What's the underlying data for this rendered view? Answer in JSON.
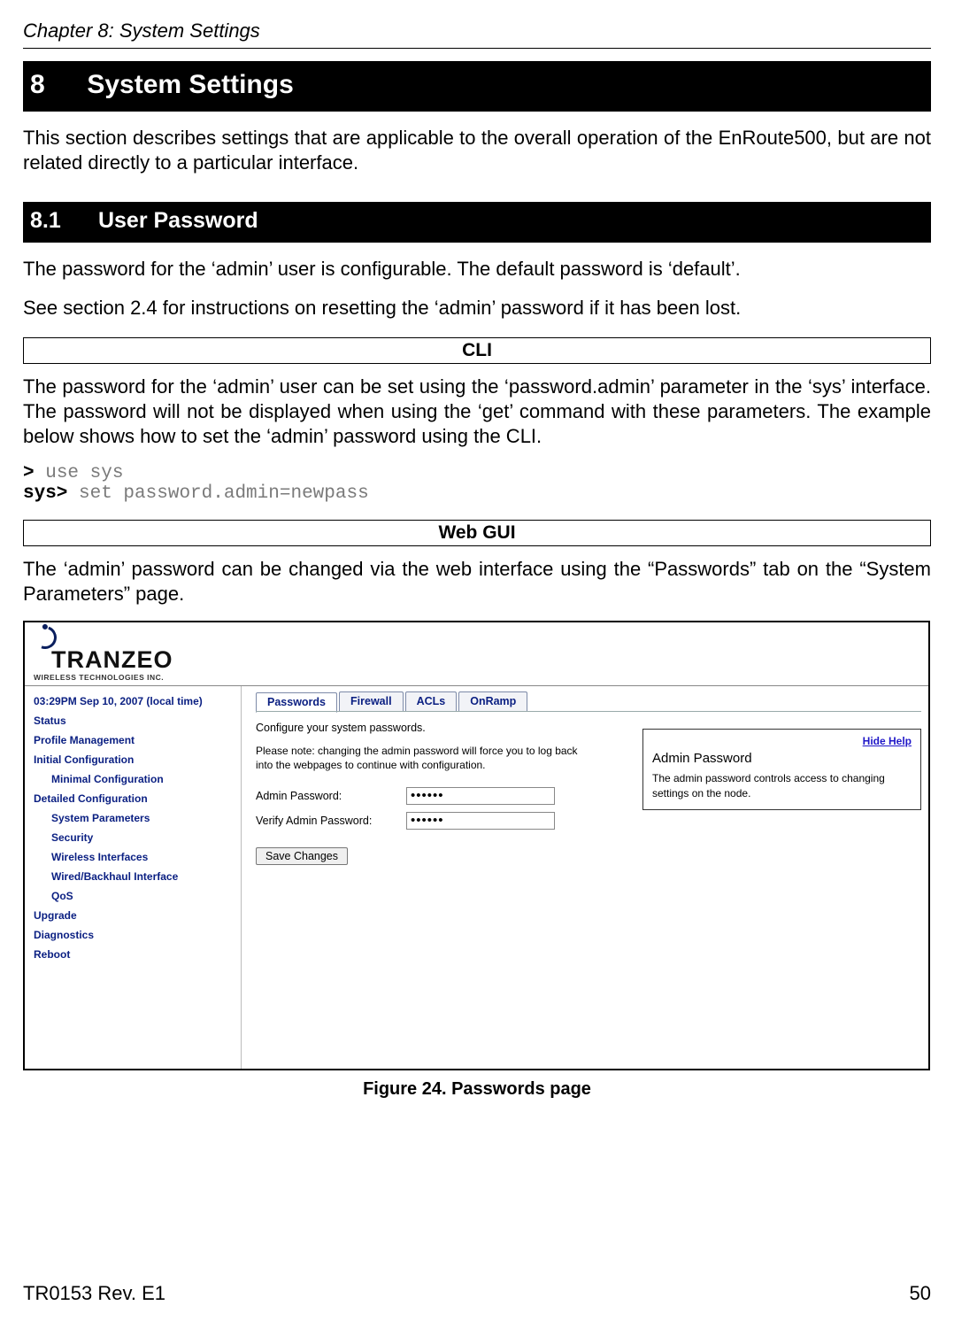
{
  "doc": {
    "chapter_header": "Chapter 8: System Settings",
    "h1_num": "8",
    "h1_title": "System Settings",
    "intro": "This section describes settings that are applicable to the overall operation of the EnRoute500, but are not related directly to a particular interface.",
    "h2_num": "8.1",
    "h2_title": "User Password",
    "p1": "The password for the ‘admin’ user is configurable. The default password is ‘default’.",
    "p2": "See section 2.4 for instructions on resetting the ‘admin’ password if it has been lost.",
    "cli_label": "CLI",
    "cli_p": "The password for the ‘admin’ user can be set using the ‘password.admin’ parameter in the ‘sys’ interface. The password will not be displayed when using the ‘get’ command with these parameters. The example below shows how to set the ‘admin’ password using the CLI.",
    "cli_line1_prompt": ">",
    "cli_line1_cmd": " use sys",
    "cli_line2_prompt": "sys>",
    "cli_line2_cmd": " set password.admin=newpass",
    "webgui_label": "Web GUI",
    "webgui_p": "The ‘admin’ password can be changed via the web interface using the “Passwords” tab on the “System Parameters” page.",
    "figcaption": "Figure 24. Passwords page",
    "footer_left": "TR0153 Rev. E1",
    "footer_right": "50"
  },
  "gui": {
    "logo_line1": "TRANZEO",
    "logo_line2": "WIRELESS  TECHNOLOGIES INC.",
    "time": "03:29PM Sep 10, 2007 (local time)",
    "sidebar": [
      {
        "label": "Status",
        "indent": 0
      },
      {
        "label": "Profile Management",
        "indent": 0
      },
      {
        "label": "Initial Configuration",
        "indent": 0,
        "head": true
      },
      {
        "label": "Minimal Configuration",
        "indent": 1
      },
      {
        "label": "Detailed Configuration",
        "indent": 0,
        "head": true
      },
      {
        "label": "System Parameters",
        "indent": 1
      },
      {
        "label": "Security",
        "indent": 1
      },
      {
        "label": "Wireless Interfaces",
        "indent": 1
      },
      {
        "label": "Wired/Backhaul Interface",
        "indent": 1
      },
      {
        "label": "QoS",
        "indent": 1
      },
      {
        "label": "Upgrade",
        "indent": 0
      },
      {
        "label": "Diagnostics",
        "indent": 0
      },
      {
        "label": "Reboot",
        "indent": 0
      }
    ],
    "tabs": [
      {
        "label": "Passwords",
        "active": true
      },
      {
        "label": "Firewall",
        "active": false
      },
      {
        "label": "ACLs",
        "active": false
      },
      {
        "label": "OnRamp",
        "active": false
      }
    ],
    "desc": "Configure your system passwords.",
    "note": "Please note: changing the admin password will force you to log back into the webpages to continue with configuration.",
    "field1_label": "Admin Password:",
    "field1_value": "••••••",
    "field2_label": "Verify Admin Password:",
    "field2_value": "••••••",
    "save_label": "Save Changes",
    "help": {
      "hide": "Hide Help",
      "title": "Admin Password",
      "body": "The admin password controls access to changing settings on the node."
    }
  }
}
